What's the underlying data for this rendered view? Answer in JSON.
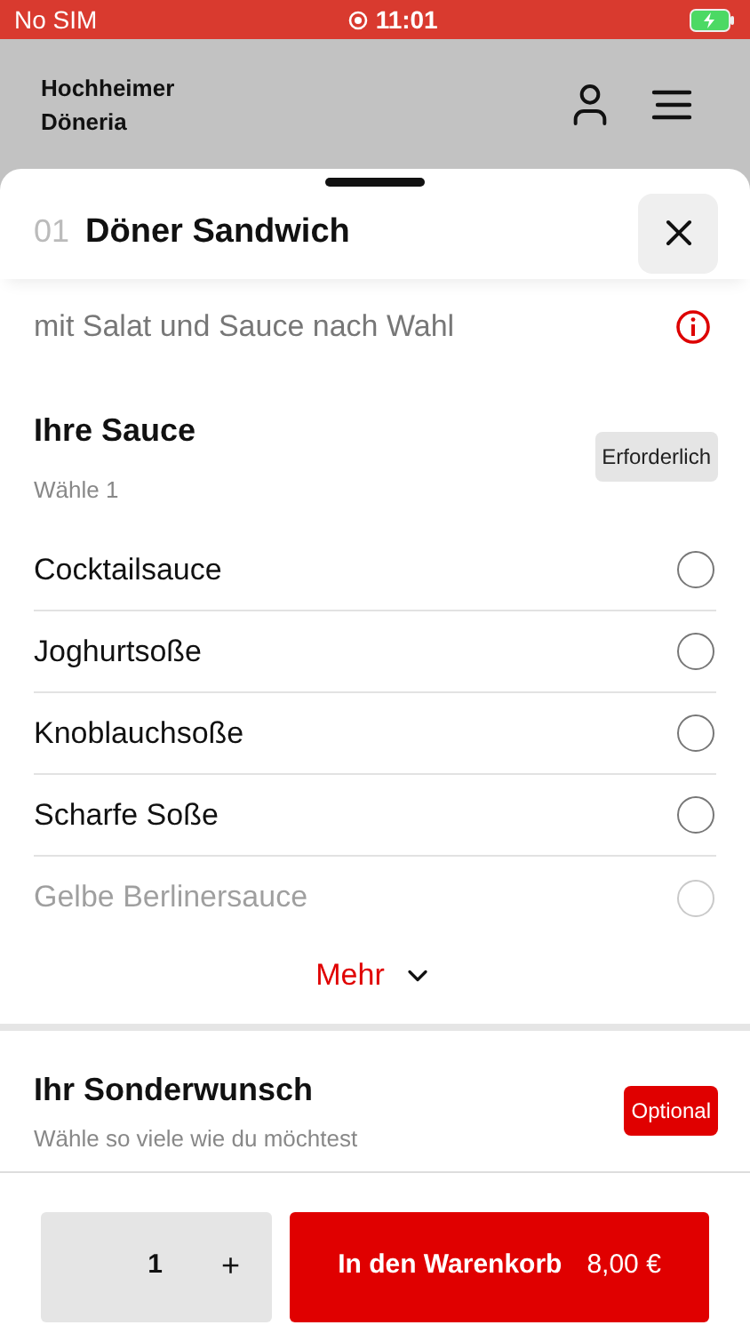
{
  "status_bar": {
    "carrier": "No SIM",
    "time": "11:01"
  },
  "header": {
    "title_line_1": "Hochheimer",
    "title_line_2": "Döneria"
  },
  "sheet": {
    "number": "01",
    "title": "Döner Sandwich",
    "description": "mit Salat und Sauce nach Wahl"
  },
  "groups": [
    {
      "title": "Ihre Sauce",
      "hint": "Wähle 1",
      "badge": "Erforderlich",
      "kind": "required",
      "options": [
        {
          "label": "Cocktailsauce",
          "selected": false,
          "faded": false
        },
        {
          "label": "Joghurtsoße",
          "selected": false,
          "faded": false
        },
        {
          "label": "Knoblauchsoße",
          "selected": false,
          "faded": false
        },
        {
          "label": "Scharfe Soße",
          "selected": false,
          "faded": false
        },
        {
          "label": "Gelbe Berlinersauce",
          "selected": false,
          "faded": true
        }
      ],
      "more": "Mehr"
    },
    {
      "title": "Ihr Sonderwunsch",
      "hint": "Wähle so viele wie du möchtest",
      "badge": "Optional",
      "kind": "optional"
    }
  ],
  "footer": {
    "quantity": "1",
    "plus": "+",
    "add_button": "In den Warenkorb",
    "price": "8,00 €"
  }
}
